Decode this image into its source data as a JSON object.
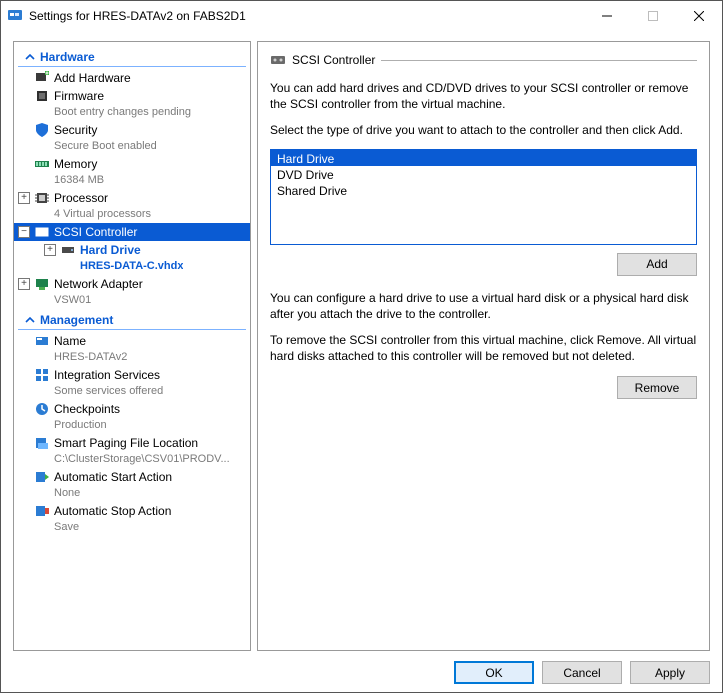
{
  "window": {
    "title": "Settings for HRES-DATAv2 on FABS2D1"
  },
  "left": {
    "sections": {
      "hardware": "Hardware",
      "management": "Management"
    },
    "items": {
      "add_hardware": {
        "label": "Add Hardware"
      },
      "firmware": {
        "label": "Firmware",
        "sub": "Boot entry changes pending"
      },
      "security": {
        "label": "Security",
        "sub": "Secure Boot enabled"
      },
      "memory": {
        "label": "Memory",
        "sub": "16384 MB"
      },
      "processor": {
        "label": "Processor",
        "sub": "4 Virtual processors"
      },
      "scsi": {
        "label": "SCSI Controller"
      },
      "hard_drive": {
        "label": "Hard Drive",
        "sub": "HRES-DATA-C.vhdx"
      },
      "network": {
        "label": "Network Adapter",
        "sub": "VSW01"
      },
      "name": {
        "label": "Name",
        "sub": "HRES-DATAv2"
      },
      "integration": {
        "label": "Integration Services",
        "sub": "Some services offered"
      },
      "checkpoints": {
        "label": "Checkpoints",
        "sub": "Production"
      },
      "smart_paging": {
        "label": "Smart Paging File Location",
        "sub": "C:\\ClusterStorage\\CSV01\\PRODV..."
      },
      "auto_start": {
        "label": "Automatic Start Action",
        "sub": "None"
      },
      "auto_stop": {
        "label": "Automatic Stop Action",
        "sub": "Save"
      }
    }
  },
  "right": {
    "title": "SCSI Controller",
    "desc1": "You can add hard drives and CD/DVD drives to your SCSI controller or remove the SCSI controller from the virtual machine.",
    "desc2": "Select the type of drive you want to attach to the controller and then click Add.",
    "options": [
      "Hard Drive",
      "DVD Drive",
      "Shared Drive"
    ],
    "selected_option_index": 0,
    "add": "Add",
    "desc3": "You can configure a hard drive to use a virtual hard disk or a physical hard disk after you attach the drive to the controller.",
    "desc4": "To remove the SCSI controller from this virtual machine, click Remove. All virtual hard disks attached to this controller will be removed but not deleted.",
    "remove": "Remove"
  },
  "buttons": {
    "ok": "OK",
    "cancel": "Cancel",
    "apply": "Apply"
  }
}
